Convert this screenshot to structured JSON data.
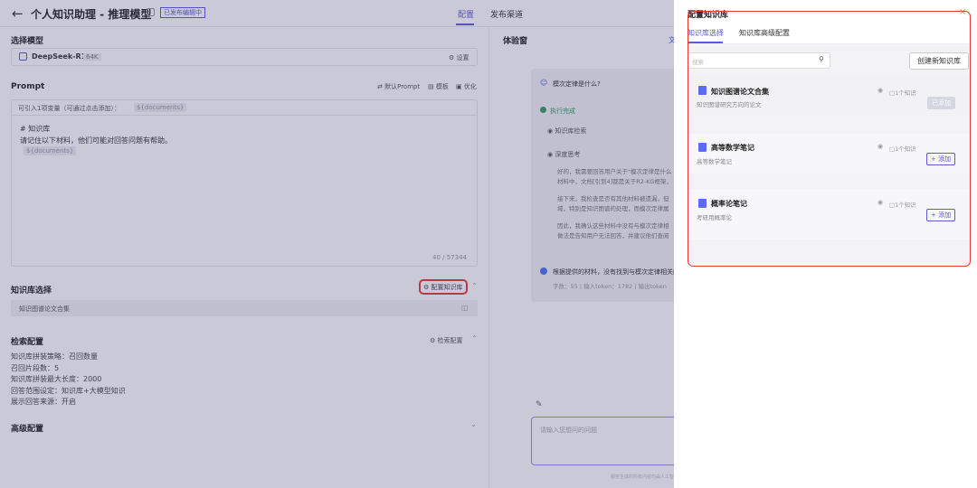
{
  "header": {
    "back_icon": "arrow-left-icon",
    "title": "个人知识助理 - 推理模型",
    "badge": "已发布编辑中",
    "tabs": [
      "配置",
      "发布渠道"
    ]
  },
  "model": {
    "section_title": "选择模型",
    "name": "DeepSeek-R1",
    "context": "64K",
    "settings_label": "设置"
  },
  "prompt": {
    "section_title": "Prompt",
    "actions": [
      "默认Prompt",
      "模板",
      "优化"
    ],
    "variable_hint": "可引入1项变量（可通过点击添加）：",
    "variable_tag": "${documents}",
    "content_line1": "# 知识库",
    "content_line2": "请记住以下材料，他们可能对回答问题有帮助。",
    "content_line3": "${documents}",
    "counter": "40 / 57344"
  },
  "knowledge": {
    "section_title": "知识库选择",
    "config_button": "配置知识库",
    "item": "知识图谱论文合集"
  },
  "retrieval": {
    "section_title": "检索配置",
    "config_button": "检索配置",
    "lines": [
      "知识库拼装策略：召回数量",
      "召回片段数：5",
      "知识库拼装最大长度：2000",
      "回答范围设定：知识库+大模型知识",
      "展示回答来源：开启"
    ]
  },
  "advanced": {
    "section_title": "高级配置"
  },
  "preview": {
    "title": "体验窗",
    "tab_fragment": "文",
    "question": "模次定律是什么?",
    "status": "执行完成",
    "step1": "知识库检索",
    "step2": "深度思考",
    "para1": [
      "好的，我需要回答用户关于\"模次定律是什么",
      "材料中，文档[引到4]都是关于R2-KG框架，"
    ],
    "para2": [
      "接下来，我检查是否有其他材料被遗漏，但",
      "域，特别是知识图谱的处理，而模次定律属"
    ],
    "para3": [
      "因此，我确认这些材料中没有与模次定律相",
      "做法是告知用户无法回答，并建议他们查阅"
    ],
    "answer": "根据提供的材料，没有找到与模次定律相关的",
    "stats": "字数：55 | 输入token：1782 | 输出token",
    "input_placeholder": "请输入您想问的问题",
    "footer_note": "服务生成的所有内容均由人工智能模型生成"
  },
  "drawer": {
    "title": "配置知识库",
    "tabs": [
      "知识库选择",
      "知识库高级配置"
    ],
    "search_placeholder": "搜索",
    "create_button": "创建新知识库",
    "cards": [
      {
        "title": "知识图谱论文合集",
        "desc": "知识图谱研究方向的论文",
        "count": "1个知识",
        "action": "已添加"
      },
      {
        "title": "高等数学笔记",
        "desc": "高等数学笔记",
        "count": "1个知识",
        "action": "+ 添加"
      },
      {
        "title": "概率论笔记",
        "desc": "考研用概率论",
        "count": "1个知识",
        "action": "+ 添加"
      }
    ]
  },
  "colors": {
    "accent": "#5b5bd6",
    "highlight": "#e53935"
  }
}
